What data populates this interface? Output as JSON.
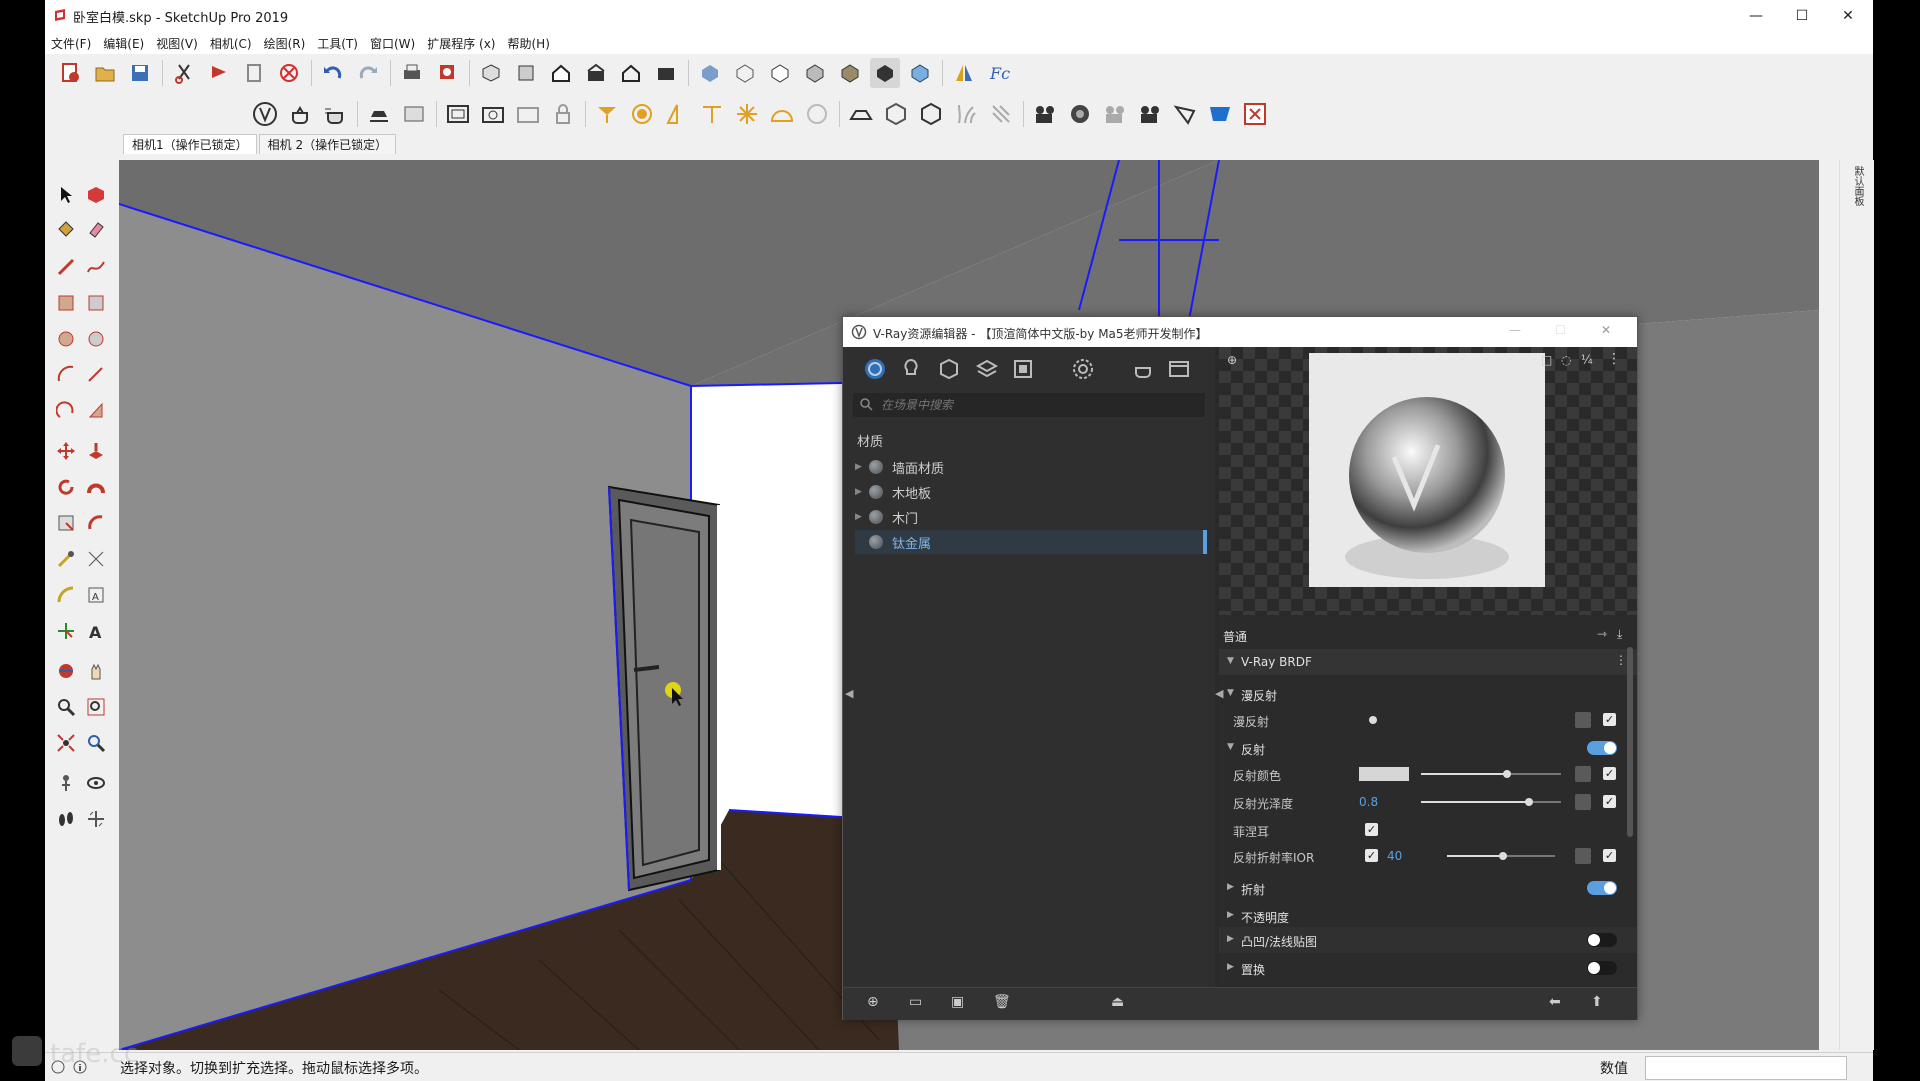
{
  "window": {
    "title": "卧室白模.skp - SketchUp Pro 2019",
    "controls": {
      "minimize": "—",
      "maximize": "☐",
      "close": "✕"
    }
  },
  "menu": [
    "文件(F)",
    "编辑(E)",
    "视图(V)",
    "相机(C)",
    "绘图(R)",
    "工具(T)",
    "窗口(W)",
    "扩展程序 (x)",
    "帮助(H)"
  ],
  "camera_tabs": [
    "相机1（操作已锁定）",
    "相机 2（操作已锁定）"
  ],
  "toolbar_icons": {
    "row1": [
      "new-file-icon",
      "open-folder-icon",
      "save-icon",
      "cut-icon",
      "copy-icon",
      "paste-icon",
      "erase-red-icon",
      "undo-icon",
      "redo-icon",
      "print-icon",
      "model-info-icon",
      "iso-view-icon",
      "top-view-icon",
      "front-view-icon",
      "right-view-icon",
      "back-view-icon",
      "left-view-icon",
      "xray-icon",
      "wireframe-icon",
      "hidden-line-icon",
      "shaded-icon",
      "shaded-texture-icon",
      "monochrome-icon",
      "section-icon",
      "extension-icon"
    ],
    "row2": [
      "vray-logo-icon",
      "asset-editor-icon",
      "render-icon",
      "interactive-render-icon",
      "frame-buffer-icon",
      "batch-render-icon",
      "lock-camera-icon",
      "rect-light-icon",
      "sphere-light-icon",
      "spot-light-icon",
      "ies-light-icon",
      "omni-light-icon",
      "dome-light-icon",
      "mesh-light-icon",
      "infinite-plane-icon",
      "proxy-icon",
      "fur-icon",
      "scatter-icon",
      "vrscene-icon",
      "clipper-icon",
      "layered-icon",
      "toon-icon",
      "denoise-icon",
      "decal-icon",
      "close-vray-icon"
    ]
  },
  "status": {
    "text": "选择对象。切换到扩充选择。拖动鼠标选择多项。",
    "value_label": "数值"
  },
  "right_panel_label": "默认面板",
  "vray_editor": {
    "title": "V-Ray资源编辑器 - 【顶渲简体中文版-by Ma5老师开发制作】",
    "search_placeholder": "在场景中搜索",
    "category": "材质",
    "materials": [
      "墙面材质",
      "木地板",
      "木门",
      "钛金属"
    ],
    "selected_material": "钛金属",
    "preview_toolbar": [
      "checker-icon",
      "teapot-icon",
      "scale-1-1-icon",
      "more-icon"
    ],
    "section_general": "普通",
    "brdf_label": "V-Ray BRDF",
    "diffuse_section": "漫反射",
    "diffuse_label": "漫反射",
    "reflection_section": "反射",
    "reflection_color_label": "反射颜色",
    "reflection_glossiness_label": "反射光泽度",
    "reflection_glossiness_value": "0.8",
    "fresnel_label": "菲涅耳",
    "fresnel_ior_label": "反射折射率IOR",
    "fresnel_ior_value": "40",
    "refraction_section": "折射",
    "opacity_section": "不透明度",
    "bump_section": "凸凹/法线贴图",
    "displacement_section": "置换",
    "reflection_color_hex": "#d6d6d6",
    "accent_color": "#5aa0e0"
  }
}
